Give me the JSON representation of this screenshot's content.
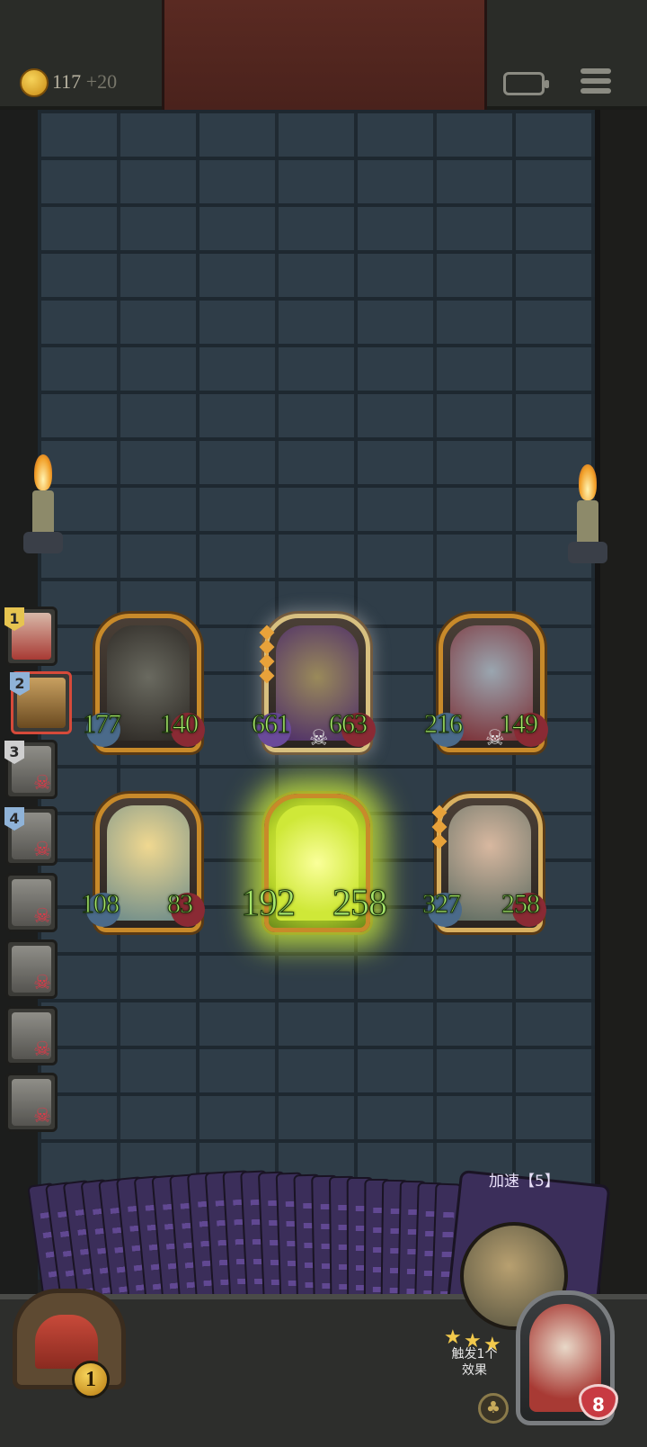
{
  "header": {
    "gold": "117",
    "gold_income": "+20",
    "icons": [
      "coin-crown-icon",
      "battery-icon",
      "menu-icon"
    ]
  },
  "queue": [
    {
      "num": "1",
      "status": "active"
    },
    {
      "num": "2",
      "status": "current"
    },
    {
      "num": "3",
      "status": "defeated"
    },
    {
      "num": "4",
      "status": "defeated"
    },
    {
      "num": "",
      "status": "defeated"
    },
    {
      "num": "",
      "status": "defeated"
    },
    {
      "num": "",
      "status": "defeated"
    },
    {
      "num": "",
      "status": "defeated"
    }
  ],
  "board": {
    "row1": [
      {
        "name": "stone-golem",
        "attack": "177",
        "health": "140"
      },
      {
        "name": "witch-wizard",
        "attack": "661",
        "health": "663"
      },
      {
        "name": "red-hair-vampire",
        "attack": "216",
        "health": "149"
      }
    ],
    "row2": [
      {
        "name": "fairy",
        "attack": "108",
        "health": "83"
      },
      {
        "name": "glowing-unit",
        "attack": "192",
        "health": "258"
      },
      {
        "name": "bearded-warrior",
        "attack": "327",
        "health": "258"
      }
    ]
  },
  "spell_card": {
    "title": "加速【5】",
    "description": "触发1个效果",
    "stars": 3
  },
  "player": {
    "gift_count": "1",
    "hp": "8"
  },
  "colors": {
    "stat_green": "#a6e46a",
    "frame_gold": "#c88a2a",
    "danger_red": "#e03848"
  }
}
